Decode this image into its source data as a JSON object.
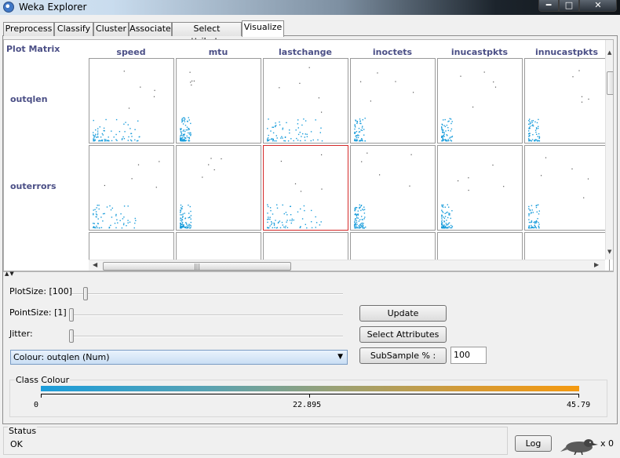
{
  "window": {
    "title": "Weka Explorer"
  },
  "tabs": [
    "Preprocess",
    "Classify",
    "Cluster",
    "Associate",
    "Select attributes",
    "Visualize"
  ],
  "active_tab": "Visualize",
  "matrix": {
    "title": "Plot Matrix",
    "columns": [
      "speed",
      "mtu",
      "lastchange",
      "inoctets",
      "inucastpkts",
      "innucastpkts"
    ],
    "rows": [
      "outqlen",
      "outerrors"
    ],
    "selected_cell": {
      "row": "outerrors",
      "column": "lastchange"
    },
    "point_color": "#1b9ddb"
  },
  "controls": {
    "plot_size_label": "PlotSize: [100]",
    "point_size_label": "PointSize: [1]",
    "jitter_label": "Jitter:",
    "plot_size_value": 100,
    "point_size_value": 1,
    "jitter_value": 0,
    "colour_select": "Colour: outqlen (Num)",
    "update_button": "Update",
    "select_attributes_button": "Select Attributes",
    "subsample_button": "SubSample % :",
    "subsample_value": "100"
  },
  "class_colour": {
    "title": "Class Colour",
    "min_label": "0",
    "mid_label": "22.895",
    "max_label": "45.79",
    "gradient_start": "#1b9ddb",
    "gradient_end": "#f59a10"
  },
  "status": {
    "title": "Status",
    "text": "OK",
    "log_button": "Log",
    "count": "x 0"
  }
}
